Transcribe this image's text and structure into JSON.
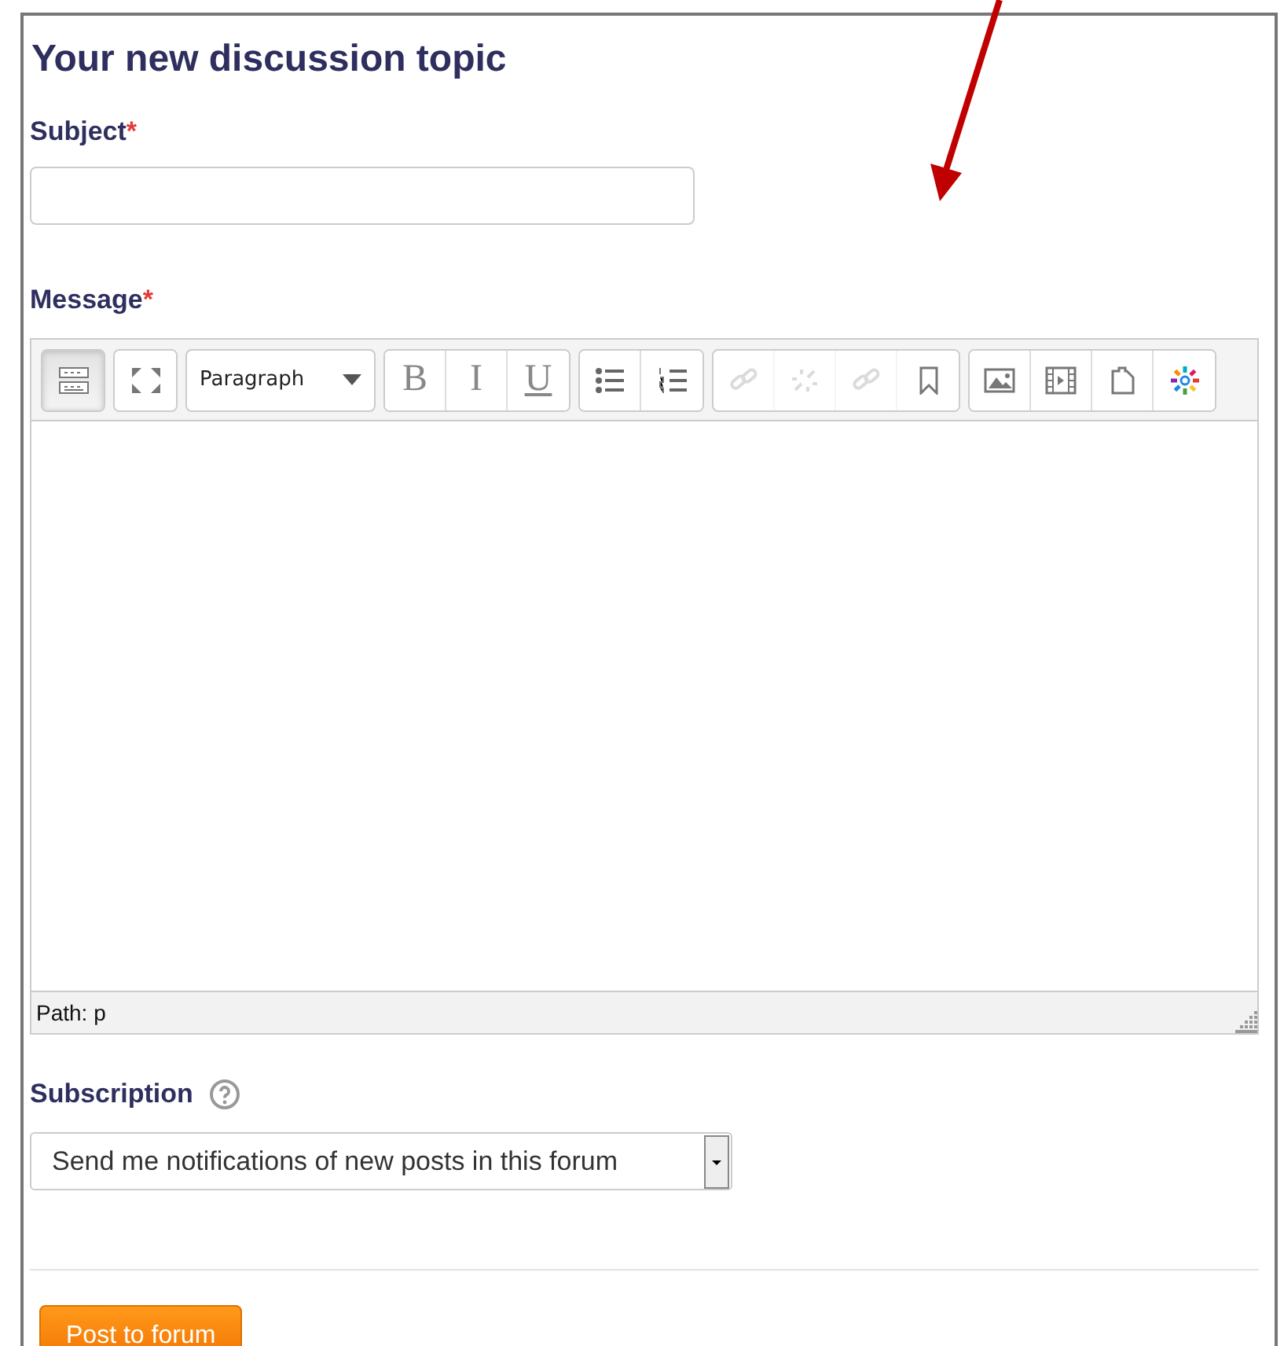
{
  "heading": "Your new discussion topic",
  "subject": {
    "label": "Subject",
    "required_mark": "*"
  },
  "message": {
    "label": "Message",
    "required_mark": "*",
    "toolbar": [
      {
        "buttons": [
          {
            "kind": "toolbar-toggle",
            "pressed": true,
            "disabled": false
          }
        ]
      },
      {
        "buttons": [
          {
            "kind": "fullscreen",
            "pressed": false,
            "disabled": false
          }
        ]
      },
      {
        "dropdown": "Paragraph"
      },
      {
        "buttons": [
          {
            "kind": "bold",
            "glyph": "B",
            "pressed": false,
            "disabled": false
          },
          {
            "kind": "italic",
            "glyph": "I",
            "pressed": false,
            "disabled": false
          },
          {
            "kind": "underline",
            "glyph": "U",
            "pressed": false,
            "disabled": false
          }
        ]
      },
      {
        "buttons": [
          {
            "kind": "bullets",
            "pressed": false,
            "disabled": false
          },
          {
            "kind": "numbers",
            "pressed": false,
            "disabled": false
          }
        ]
      },
      {
        "buttons": [
          {
            "kind": "link",
            "pressed": false,
            "disabled": true
          },
          {
            "kind": "unlink",
            "pressed": false,
            "disabled": true
          },
          {
            "kind": "link",
            "pressed": false,
            "disabled": true
          },
          {
            "kind": "bookmark",
            "pressed": false,
            "disabled": false
          }
        ]
      },
      {
        "buttons": [
          {
            "kind": "image",
            "pressed": false,
            "disabled": false
          },
          {
            "kind": "video",
            "pressed": false,
            "disabled": false
          },
          {
            "kind": "paste",
            "pressed": false,
            "disabled": false
          },
          {
            "kind": "burst",
            "pressed": false,
            "disabled": false
          }
        ]
      }
    ],
    "path": "Path: p"
  },
  "subscription": {
    "label": "Subscription",
    "value": "Send me notifications of new posts in this forum"
  },
  "submit": "Post to forum"
}
